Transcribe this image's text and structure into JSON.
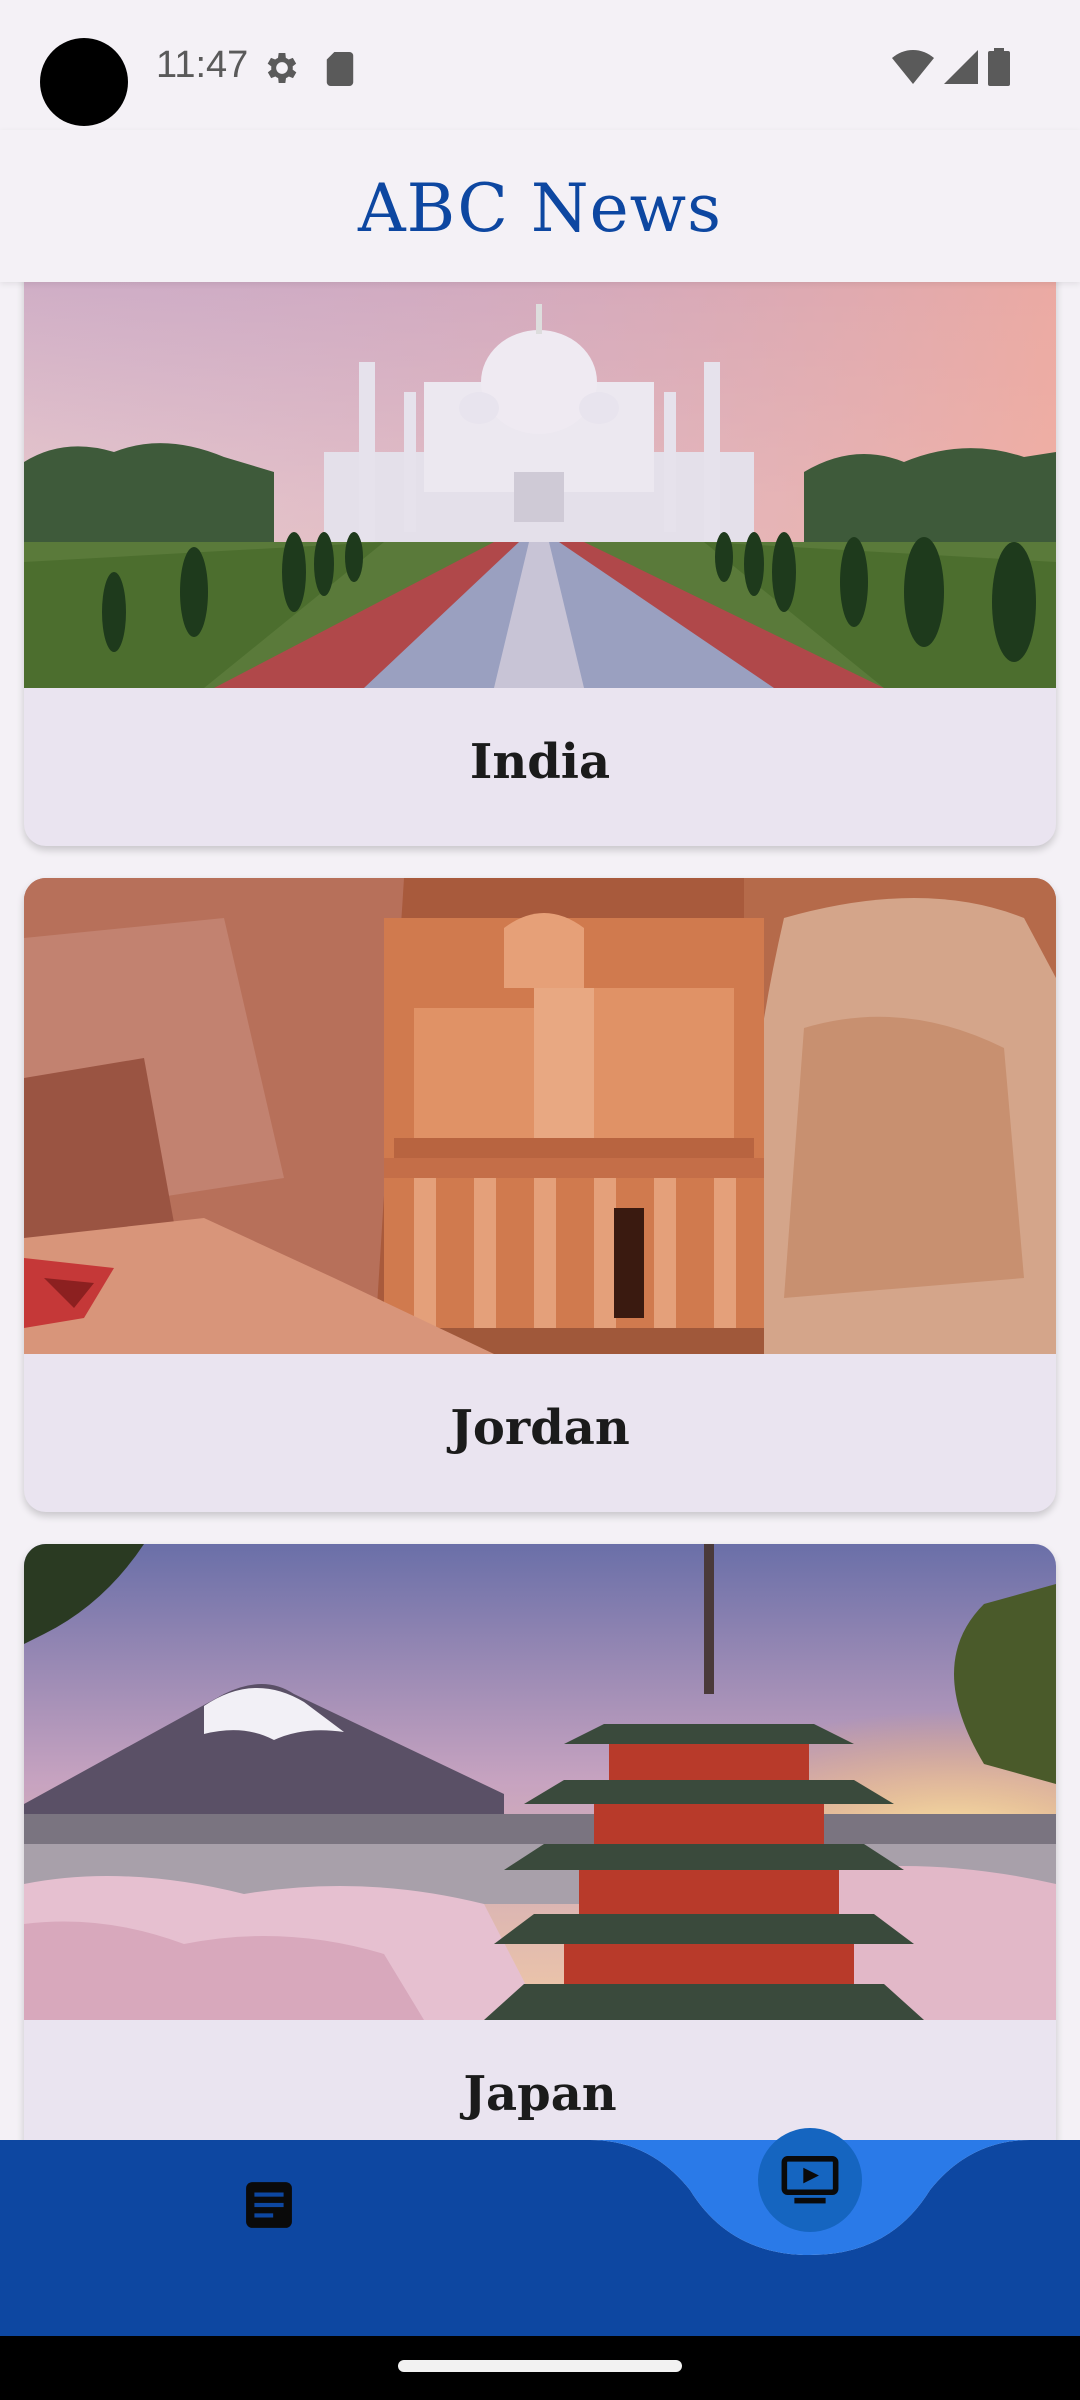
{
  "status_bar": {
    "time": "11:47",
    "icons": [
      "settings-gear-icon",
      "sd-card-icon",
      "wifi-icon",
      "cell-signal-icon",
      "battery-icon"
    ]
  },
  "header": {
    "title": "ABC News",
    "title_color": "#0d47a1"
  },
  "cards": [
    {
      "label": "India",
      "image": "taj-mahal-photo"
    },
    {
      "label": "Jordan",
      "image": "petra-treasury-photo"
    },
    {
      "label": "Japan",
      "image": "mount-fuji-pagoda-photo"
    }
  ],
  "bottom_nav": {
    "items": [
      {
        "icon": "article-icon"
      },
      {
        "icon": "live-tv-icon",
        "selected": true
      }
    ],
    "bar_color": "#0d47a1",
    "accent_color": "#1565c0"
  }
}
